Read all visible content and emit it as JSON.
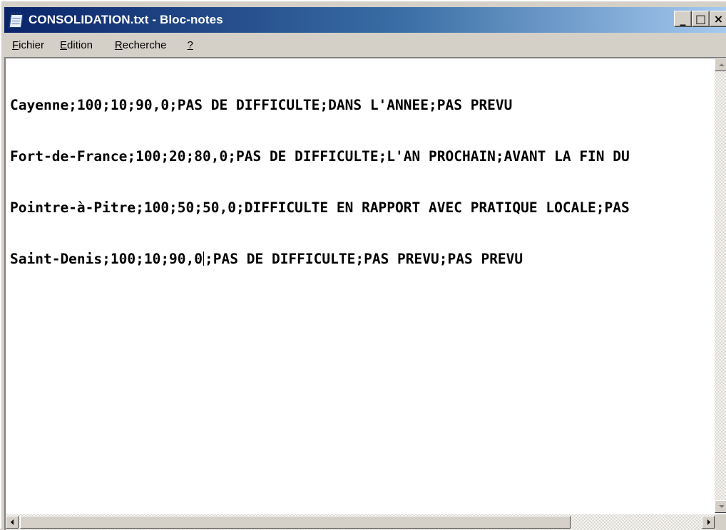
{
  "window": {
    "title": "CONSOLIDATION.txt - Bloc-notes",
    "controls": [
      "_",
      "□",
      "×"
    ]
  },
  "menu": [
    {
      "label": "Fichier",
      "mnemonic": "F",
      "rest": "ichier"
    },
    {
      "label": "Edition",
      "mnemonic": "E",
      "rest": "dition"
    },
    {
      "label": "Recherche",
      "mnemonic": "R",
      "rest": "echerche"
    },
    {
      "label": "?",
      "mnemonic": "?",
      "rest": ""
    }
  ],
  "document": {
    "lines": [
      "Cayenne;100;10;90,0;PAS DE DIFFICULTE;DANS L'ANNEE;PAS PREVU",
      "Fort-de-France;100;20;80,0;PAS DE DIFFICULTE;L'AN PROCHAIN;AVANT LA FIN DU",
      "Pointre-à-Pitre;100;50;50,0;DIFFICULTE EN RAPPORT AVEC PRATIQUE LOCALE;PAS",
      "Saint-Denis;100;10;90,0",
      ";PAS DE DIFFICULTE;PAS PREVU;PAS PREVU"
    ]
  },
  "icons": {
    "app": "notepad-icon",
    "scroll_up": "arrow-up-icon",
    "scroll_down": "arrow-down-icon",
    "scroll_left": "arrow-left-icon",
    "scroll_right": "arrow-right-icon"
  }
}
